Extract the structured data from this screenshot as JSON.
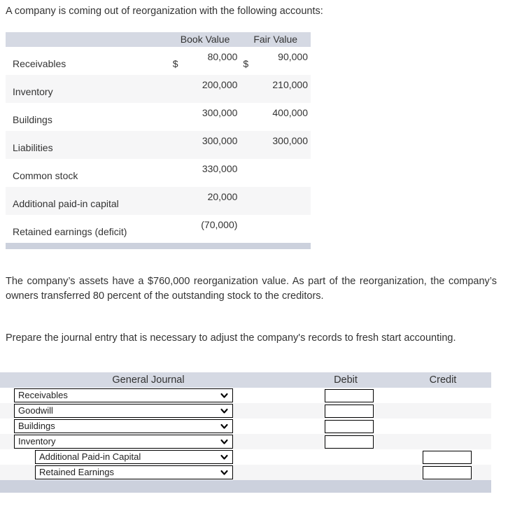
{
  "intro": {
    "text": "A company is coming out of reorganization with the following accounts:"
  },
  "balances_table": {
    "headers": {
      "label": "",
      "book_value": "Book Value",
      "fair_value": "Fair Value"
    },
    "currency_symbol": "$",
    "rows": [
      {
        "label": "Receivables",
        "book_value": "80,000",
        "fair_value": "90,000",
        "show_currency": true
      },
      {
        "label": "Inventory",
        "book_value": "200,000",
        "fair_value": "210,000",
        "show_currency": false
      },
      {
        "label": "Buildings",
        "book_value": "300,000",
        "fair_value": "400,000",
        "show_currency": false
      },
      {
        "label": "Liabilities",
        "book_value": "300,000",
        "fair_value": "300,000",
        "show_currency": false
      },
      {
        "label": "Common stock",
        "book_value": "330,000",
        "fair_value": "",
        "show_currency": false
      },
      {
        "label": "Additional paid-in capital",
        "book_value": "20,000",
        "fair_value": "",
        "show_currency": false
      },
      {
        "label": "Retained earnings (deficit)",
        "book_value": "(70,000)",
        "fair_value": "",
        "show_currency": false
      }
    ]
  },
  "paragraphs": {
    "reorganization": "The company’s assets have a $760,000 reorganization value. As part of the reorganization, the company’s owners transferred 80 percent of the outstanding stock to the creditors.",
    "prepare": "Prepare the journal entry that is necessary to adjust the company's records to fresh start accounting."
  },
  "journal_table": {
    "headers": {
      "general_journal": "General Journal",
      "debit": "Debit",
      "credit": "Credit"
    },
    "rows": [
      {
        "account": "Receivables",
        "indented": false,
        "debit": "",
        "credit": "",
        "has_debit_box": true,
        "has_credit_box": false
      },
      {
        "account": "Goodwill",
        "indented": false,
        "debit": "",
        "credit": "",
        "has_debit_box": true,
        "has_credit_box": false
      },
      {
        "account": "Buildings",
        "indented": false,
        "debit": "",
        "credit": "",
        "has_debit_box": true,
        "has_credit_box": false
      },
      {
        "account": "Inventory",
        "indented": false,
        "debit": "",
        "credit": "",
        "has_debit_box": true,
        "has_credit_box": false
      },
      {
        "account": "Additional Paid-in Capital",
        "indented": true,
        "debit": "",
        "credit": "",
        "has_debit_box": false,
        "has_credit_box": true
      },
      {
        "account": "Retained Earnings",
        "indented": true,
        "debit": "",
        "credit": "",
        "has_debit_box": false,
        "has_credit_box": true
      }
    ]
  },
  "colors": {
    "header_band": "#d5d9e3",
    "footer_band": "#ccd1dd",
    "row_alt": "#f5f5f6",
    "text": "#333333",
    "box_border": "#000000"
  }
}
